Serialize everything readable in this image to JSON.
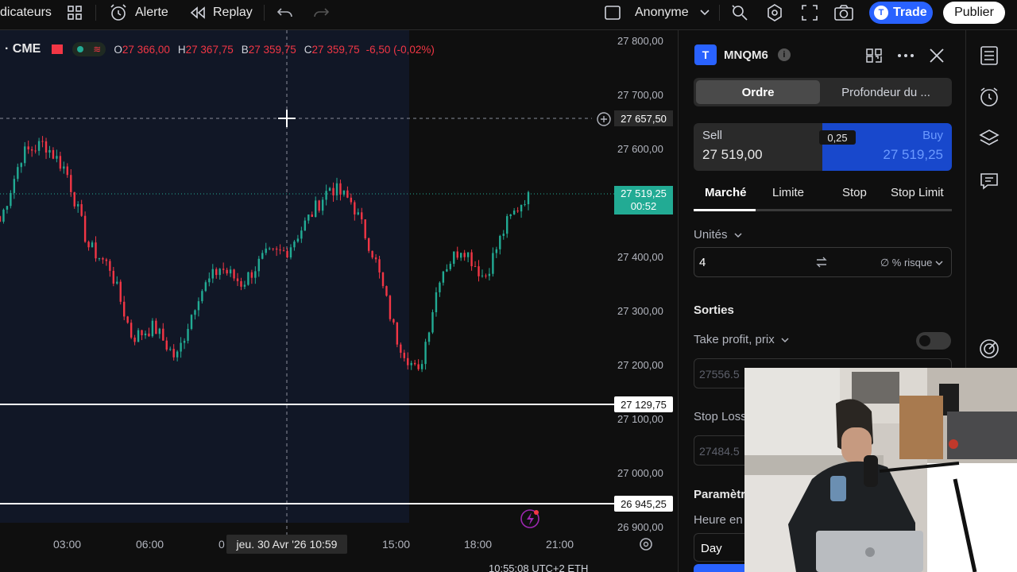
{
  "toolbar": {
    "indicators_label": "dicateurs",
    "alert_label": "Alerte",
    "replay_label": "Replay",
    "account_label": "Anonyme",
    "trade_label": "Trade",
    "publish_label": "Publier"
  },
  "legend": {
    "exchange": "· CME",
    "open_key": "O",
    "open": "27 366,00",
    "high_key": "H",
    "high": "27 367,75",
    "bid_key": "B",
    "bid": "27 359,75",
    "close_key": "C",
    "close": "27 359,75",
    "change": "-6,50 (-0,02%)"
  },
  "price_axis": [
    "27 800,00",
    "27 700,00",
    "27 600,00",
    "27 400,00",
    "27 300,00",
    "27 200,00",
    "27 100,00",
    "27 000,00",
    "26 900,00"
  ],
  "crosshair_price": "27 657,50",
  "last_price": "27 519,25",
  "countdown": "00:52",
  "level_1": "27 129,75",
  "level_2": "26 945,25",
  "time_axis": [
    "03:00",
    "06:00",
    "0",
    "15:00",
    "18:00",
    "21:00"
  ],
  "crosshair_time": "jeu. 30 Avr '26   10:59",
  "chart_data": {
    "type": "candlestick",
    "ylim": [
      26900,
      27800
    ],
    "x": [
      "03:00",
      "06:00",
      "15:00",
      "18:00",
      "21:00"
    ],
    "levels": [
      27657.5,
      27519.25,
      27129.75,
      26945.25
    ],
    "series": [
      {
        "values": [
          27465,
          27590,
          27610,
          27560,
          27420,
          27380,
          27250,
          27270,
          27210,
          27330,
          27380,
          27350,
          27400,
          27410,
          27470,
          27530,
          27500,
          27400,
          27250,
          27180,
          27370,
          27420,
          27360,
          27460,
          27519.25
        ]
      }
    ]
  },
  "panel": {
    "symbol": "MNQM6",
    "tab_order": "Ordre",
    "tab_depth": "Profondeur du ...",
    "sell_label": "Sell",
    "sell_price": "27 519,00",
    "spread": "0,25",
    "buy_label": "Buy",
    "buy_price": "27 519,25",
    "order_types": [
      "Marché",
      "Limite",
      "Stop",
      "Stop Limit"
    ],
    "units_label": "Unités",
    "units_value": "4",
    "risk_label": "∅ % risque",
    "exits_label": "Sorties",
    "tp_label": "Take profit, prix",
    "tp_value": "27556.5",
    "sl_label": "Stop Loss",
    "sl_value": "27484.5",
    "params_label": "Paramètr",
    "time_label": "Heure en",
    "tif_value": "Day"
  },
  "status_bar": "10:55:08 UTC+2   ETH"
}
